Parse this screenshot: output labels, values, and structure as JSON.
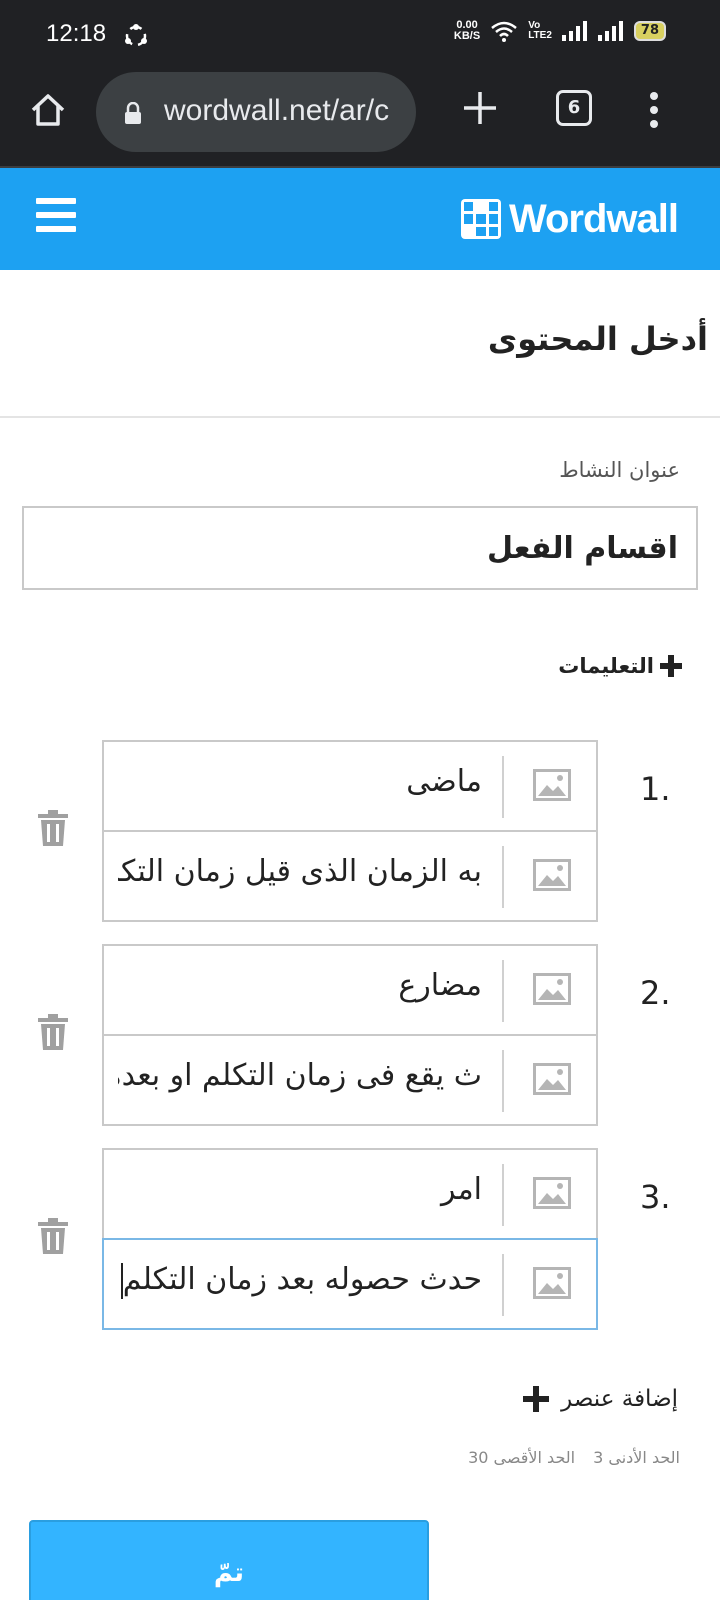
{
  "status_bar": {
    "time": "12:18",
    "net_speed_value": "0.00",
    "net_speed_unit": "KB/S",
    "volte_top": "Vo",
    "volte_bottom": "LTE2",
    "battery": "78"
  },
  "browser": {
    "url": "wordwall.net/ar/c",
    "tab_count": "6"
  },
  "app": {
    "logo_text": "Wordwall",
    "brand_color": "#1da1f2"
  },
  "form": {
    "page_title": "أدخل المحتوى",
    "activity_title_label": "عنوان النشاط",
    "activity_title_value": "اقسام الفعل",
    "instructions_label": "التعليمات",
    "items": [
      {
        "number": "1.",
        "term": "ماضى",
        "definition": "به الزمان الذى قيل زمان التكلم"
      },
      {
        "number": "2.",
        "term": "مضارع",
        "definition": "ث يقع فى زمان التكلم او بعده"
      },
      {
        "number": "3.",
        "term": "امر",
        "definition": "حدث حصوله بعد زمان التكلم"
      }
    ],
    "add_item_label": "إضافة عنصر",
    "min_label": "الحد الأدنى 3",
    "max_label": "الحد الأقصى 30",
    "done_label": "تمّ"
  }
}
